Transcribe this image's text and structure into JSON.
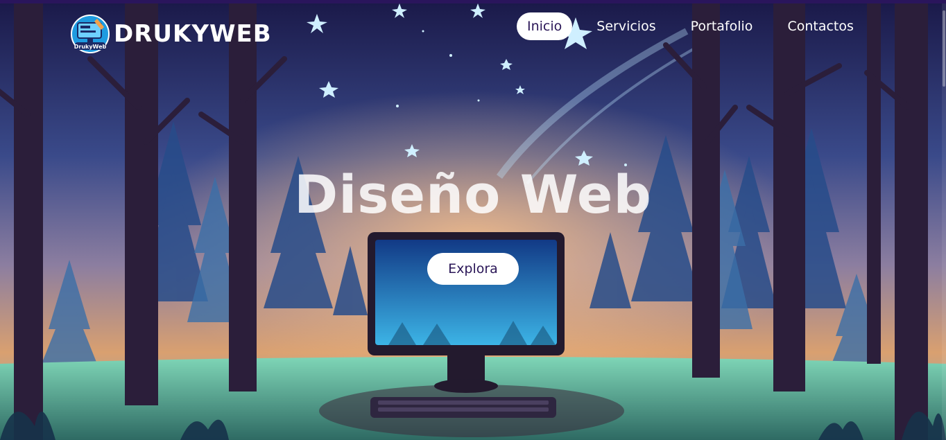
{
  "brand": {
    "name": "DRUKYWEB",
    "logo_text": "DrukyWeb"
  },
  "nav": {
    "items": [
      {
        "label": "Inicio",
        "active": true
      },
      {
        "label": "Servicios",
        "active": false
      },
      {
        "label": "Portafolio",
        "active": false
      },
      {
        "label": "Contactos",
        "active": false
      }
    ]
  },
  "hero": {
    "title": "Diseño Web",
    "cta_label": "Explora",
    "background": "night-forest-with-computer-illustration"
  },
  "colors": {
    "accent": "#2a1657",
    "nav_active_bg": "#ffffff",
    "sky_top": "#1d1a4f",
    "sky_glow": "#f2a860"
  }
}
